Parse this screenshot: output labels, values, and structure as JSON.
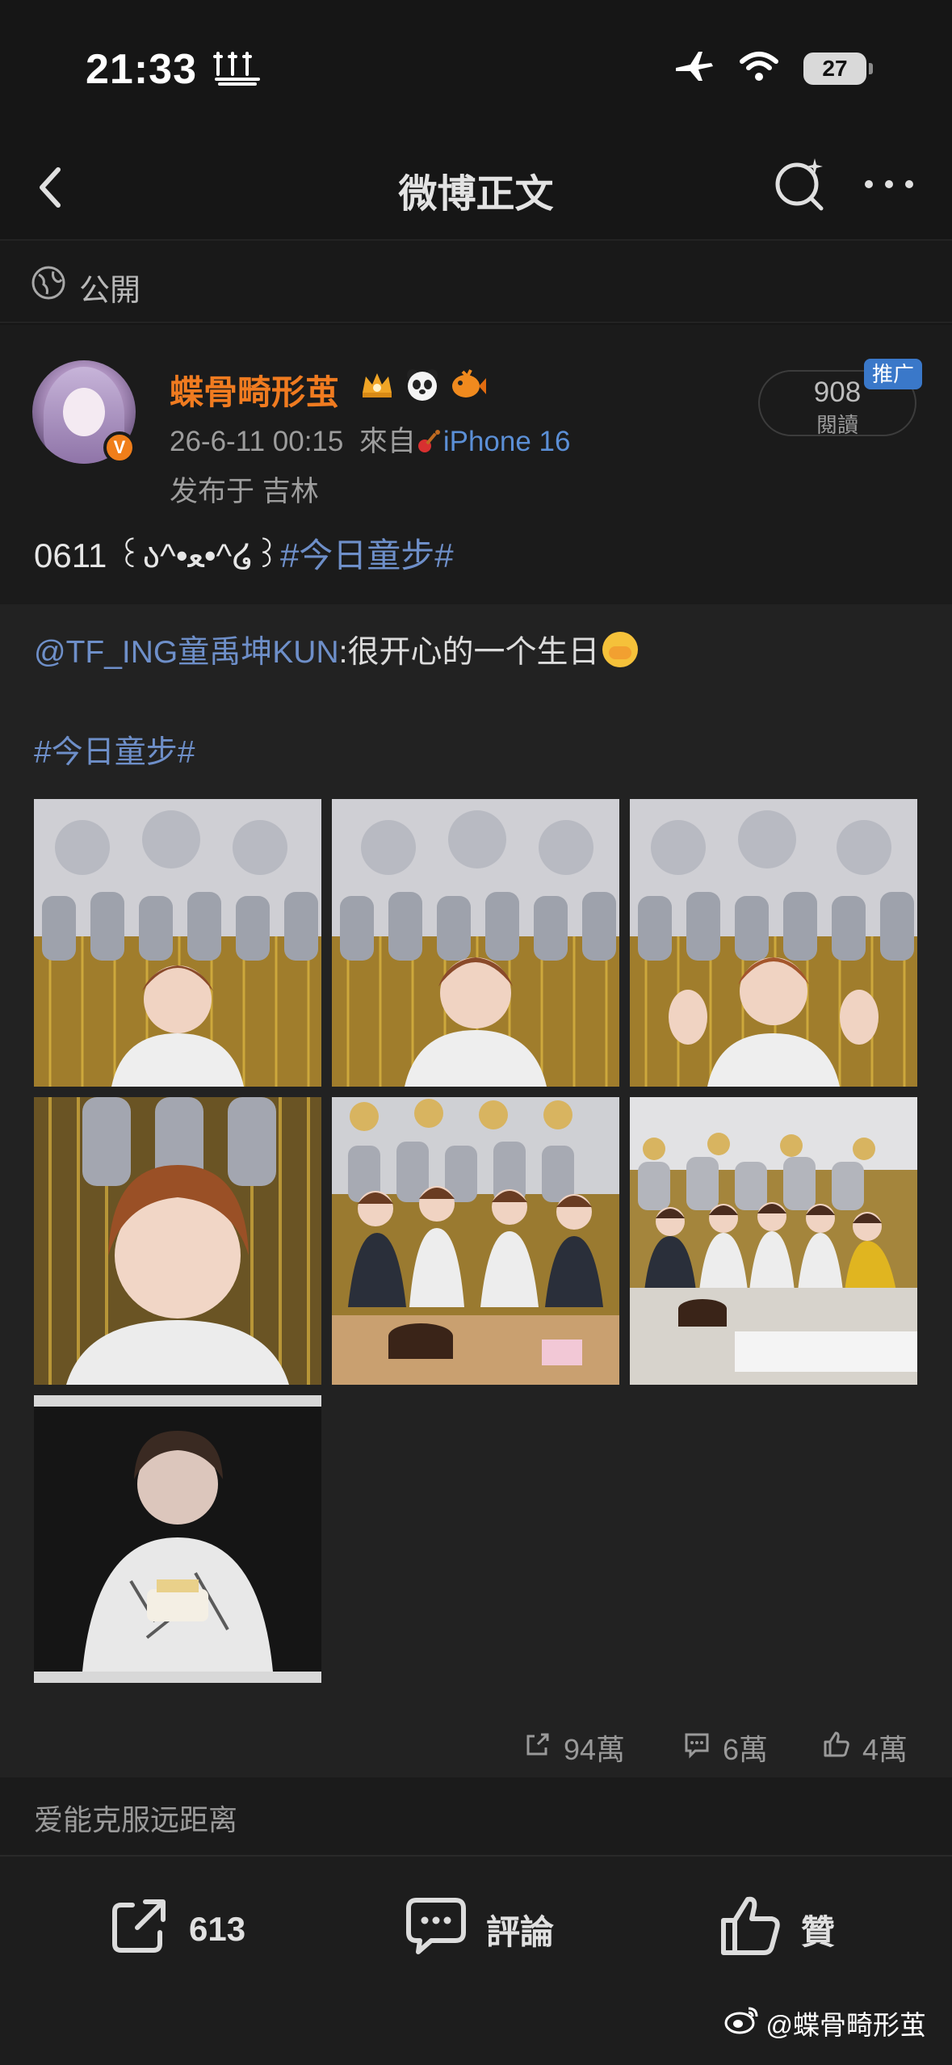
{
  "status_bar": {
    "time": "21:33",
    "battery": "27"
  },
  "nav": {
    "title": "微博正文"
  },
  "privacy": {
    "label": "公開"
  },
  "post": {
    "username": "蝶骨畸形茧",
    "verified_mark": "V",
    "timestamp": "26-6-11 00:15",
    "source_prefix": "來自",
    "source_device": "iPhone 16",
    "location": "发布于 吉林",
    "read_count": "908",
    "read_label": "閱讀",
    "promo_tag": "推广",
    "text_prefix": "0611 ꒰ა^•ﻌ•^໒꒱",
    "text_tag": "#今日童步#"
  },
  "repost": {
    "mention": "@TF_ING童禹坤KUN",
    "text": ":很开心的一个生日",
    "hashtag": "#今日童步#",
    "image_count": 7
  },
  "stats": {
    "shares": "94萬",
    "comments": "6萬",
    "likes": "4萬"
  },
  "related": {
    "label": "爱能克服远距离"
  },
  "actions": {
    "repost_count": "613",
    "comment_label": "評論",
    "like_label": "贊"
  },
  "watermark": {
    "text": "@蝶骨畸形茧"
  },
  "colors": {
    "accent_orange": "#f07b20",
    "link_blue": "#6e8fc9",
    "background": "#161616"
  }
}
